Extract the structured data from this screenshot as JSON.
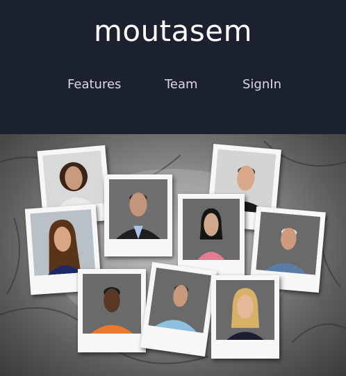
{
  "brand": {
    "title": "moutasem"
  },
  "nav": {
    "items": [
      {
        "label": "Features"
      },
      {
        "label": "Team"
      },
      {
        "label": "SignIn"
      }
    ]
  },
  "colors": {
    "header_bg": "#1c2130",
    "brand_text": "#ffffff",
    "nav_text": "#d8dbe3"
  },
  "hero": {
    "photos": [
      {
        "bg": "#d9d9d9",
        "skin": "#c99a7c",
        "hair": "#3a2418",
        "shirt": "#e9e9e9"
      },
      {
        "bg": "#6f6f6f",
        "skin": "#c4957a",
        "hair": "#2a2a2a",
        "shirt": "#1e1e1e"
      },
      {
        "bg": "#d4d4d4",
        "skin": "#d9a88a",
        "hair": "#4a4a4a",
        "shirt": "#1a1a1a"
      },
      {
        "bg": "#b9c0c8",
        "skin": "#d8a585",
        "hair": "#5a3418",
        "shirt": "#1d2a66"
      },
      {
        "bg": "#6a6a6a",
        "skin": "#d2a88c",
        "hair": "#151515",
        "shirt": "#e27d8f"
      },
      {
        "bg": "#6a6a6a",
        "skin": "#d09a7e",
        "hair": "#e3e3e3",
        "shirt": "#5a7da8"
      },
      {
        "bg": "#6b6b6b",
        "skin": "#5a3625",
        "hair": "#1a1a1a",
        "shirt": "#ec7a2e"
      },
      {
        "bg": "#6a6a6a",
        "skin": "#c9987c",
        "hair": "#3a3a3a",
        "shirt": "#8ec0e0"
      },
      {
        "bg": "#6a6a6a",
        "skin": "#e8b89a",
        "hair": "#d6b166",
        "shirt": "#1b1e33"
      }
    ]
  }
}
